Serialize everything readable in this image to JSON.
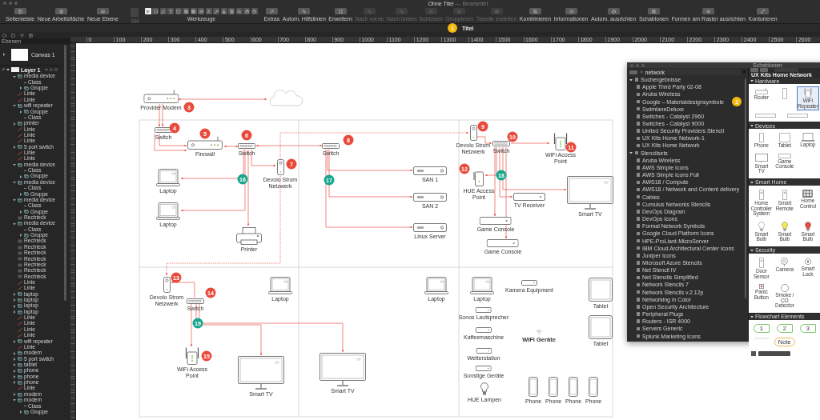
{
  "window": {
    "title": "Ohne Titel",
    "subtitle": "— Bearbeitet"
  },
  "toolbar": {
    "left": [
      {
        "label": "Seitenleiste",
        "disabled": false
      },
      {
        "label": "Neue Arbeitsfläche",
        "disabled": false
      },
      {
        "label": "Neue Ebene",
        "disabled": false
      }
    ],
    "style": {
      "label": "Stil",
      "disabled": true
    },
    "tools": {
      "label": "Werkzeuge",
      "items": [
        {
          "selected": true
        },
        {
          "selected": false
        },
        {
          "selected": false
        },
        {
          "selected": false
        },
        {
          "selected": false
        },
        {
          "selected": false
        },
        {
          "selected": false
        },
        {
          "selected": false
        },
        {
          "selected": false
        },
        {
          "selected": false
        },
        {
          "selected": false
        },
        {
          "selected": false
        },
        {
          "selected": false
        },
        {
          "selected": false
        },
        {
          "selected": false
        }
      ]
    },
    "right": [
      {
        "label": "Extras",
        "disabled": false
      },
      {
        "label": "Autom. Hilfslinien",
        "disabled": false
      },
      {
        "label": "Erweitern",
        "disabled": false
      },
      {
        "label": "Nach vorne",
        "disabled": true
      },
      {
        "label": "Nach hinten",
        "disabled": true
      },
      {
        "label": "Schützen",
        "disabled": true
      },
      {
        "label": "Gruppieren",
        "disabled": true
      },
      {
        "label": "Tabelle erstellen",
        "disabled": true
      },
      {
        "label": "Kombinieren",
        "disabled": false
      },
      {
        "label": "Informationen",
        "disabled": false
      },
      {
        "label": "Autom. ausrichten",
        "disabled": false
      },
      {
        "label": "Schablonen",
        "disabled": false
      },
      {
        "label": "Formen am Raster ausrichten",
        "disabled": false
      },
      {
        "label": "Konturieren",
        "disabled": false
      }
    ]
  },
  "tab_bar": {
    "callout": {
      "label": "1",
      "color": "#f5b80f"
    },
    "tabs": [
      {
        "label": "Titel",
        "selected": true
      }
    ]
  },
  "sidebar": {
    "header": "Ebenen",
    "canvas": {
      "label": "Canvas 1"
    },
    "layer": {
      "label": "Layer 1",
      "expanded": true,
      "children": [
        {
          "label": "media device",
          "kind": "group",
          "expanded": true,
          "children": [
            {
              "label": "Class",
              "kind": "class"
            },
            {
              "label": "Gruppe",
              "kind": "group",
              "expanded": false
            }
          ]
        },
        {
          "label": "Linie",
          "kind": "line"
        },
        {
          "label": "Linie",
          "kind": "line"
        },
        {
          "label": "wifi repeater",
          "kind": "group",
          "expanded": true,
          "children": [
            {
              "label": "Gruppe",
              "kind": "group",
              "expanded": false
            },
            {
              "label": "Class",
              "kind": "class"
            }
          ]
        },
        {
          "label": "printer",
          "kind": "group",
          "expanded": false
        },
        {
          "label": "Linie",
          "kind": "line"
        },
        {
          "label": "Linie",
          "kind": "line"
        },
        {
          "label": "Linie",
          "kind": "line"
        },
        {
          "label": "5 port switch",
          "kind": "group",
          "expanded": false
        },
        {
          "label": "Linie",
          "kind": "line"
        },
        {
          "label": "Linie",
          "kind": "line"
        },
        {
          "label": "media device",
          "kind": "group",
          "expanded": true,
          "children": [
            {
              "label": "Class",
              "kind": "class"
            },
            {
              "label": "Gruppe",
              "kind": "group",
              "expanded": false
            }
          ]
        },
        {
          "label": "media device",
          "kind": "group",
          "expanded": true,
          "children": [
            {
              "label": "Class",
              "kind": "class"
            },
            {
              "label": "Gruppe",
              "kind": "group",
              "expanded": false
            }
          ]
        },
        {
          "label": "media device",
          "kind": "group",
          "expanded": true,
          "children": [
            {
              "label": "Class",
              "kind": "class"
            },
            {
              "label": "Gruppe",
              "kind": "group",
              "expanded": false
            }
          ]
        },
        {
          "label": "Rechteck",
          "kind": "shape"
        },
        {
          "label": "media device",
          "kind": "group",
          "expanded": true,
          "children": [
            {
              "label": "Class",
              "kind": "class"
            },
            {
              "label": "Gruppe",
              "kind": "group",
              "expanded": false
            }
          ]
        },
        {
          "label": "Rechteck",
          "kind": "shape"
        },
        {
          "label": "Rechteck",
          "kind": "shape"
        },
        {
          "label": "Rechteck",
          "kind": "shape"
        },
        {
          "label": "Rechteck",
          "kind": "shape"
        },
        {
          "label": "Rechteck",
          "kind": "shape"
        },
        {
          "label": "Rechteck",
          "kind": "shape"
        },
        {
          "label": "Rechteck",
          "kind": "shape"
        },
        {
          "label": "Linie",
          "kind": "line"
        },
        {
          "label": "Linie",
          "kind": "line"
        },
        {
          "label": "laptop",
          "kind": "group",
          "expanded": false
        },
        {
          "label": "laptop",
          "kind": "group",
          "expanded": false
        },
        {
          "label": "laptop",
          "kind": "group",
          "expanded": false
        },
        {
          "label": "laptop",
          "kind": "group",
          "expanded": false
        },
        {
          "label": "Linie",
          "kind": "line"
        },
        {
          "label": "Linie",
          "kind": "line"
        },
        {
          "label": "Linie",
          "kind": "line"
        },
        {
          "label": "Linie",
          "kind": "line"
        },
        {
          "label": "wifi repeater",
          "kind": "group",
          "expanded": false
        },
        {
          "label": "Linie",
          "kind": "line"
        },
        {
          "label": "modem",
          "kind": "group",
          "expanded": false
        },
        {
          "label": "5 port switch",
          "kind": "group",
          "expanded": false
        },
        {
          "label": "tablet",
          "kind": "group",
          "expanded": false
        },
        {
          "label": "phone",
          "kind": "group",
          "expanded": false
        },
        {
          "label": "phone",
          "kind": "group",
          "expanded": false
        },
        {
          "label": "phone",
          "kind": "group",
          "expanded": false
        },
        {
          "label": "Linie",
          "kind": "line"
        },
        {
          "label": "modem",
          "kind": "group",
          "expanded": false
        },
        {
          "label": "modem",
          "kind": "group",
          "expanded": true,
          "children": [
            {
              "label": "Class",
              "kind": "class"
            },
            {
              "label": "Gruppe",
              "kind": "group",
              "expanded": false
            }
          ]
        }
      ]
    }
  },
  "ruler": {
    "labels": [
      "0",
      "100",
      "200",
      "300",
      "400",
      "500",
      "600",
      "700",
      "800",
      "900",
      "1000",
      "1100",
      "1200",
      "1300",
      "1400",
      "1500",
      "1600",
      "1700",
      "1800",
      "1900",
      "2000",
      "2100",
      "2200",
      "2300",
      "2400",
      "2500",
      "2600"
    ]
  },
  "diagram": {
    "nodes": [
      {
        "label": "Provider Modem",
        "kind": "router"
      },
      {
        "label": "Switch",
        "kind": "switch"
      },
      {
        "label": "Firewall",
        "kind": "router"
      },
      {
        "label": "Switch",
        "kind": "switch"
      },
      {
        "label": "Devolo Strom Netzwerk",
        "kind": "powerline"
      },
      {
        "label": "Switch",
        "kind": "switch"
      },
      {
        "label": "Laptop",
        "kind": "laptop"
      },
      {
        "label": "Laptop",
        "kind": "laptop"
      },
      {
        "label": "Printer",
        "kind": "printer"
      },
      {
        "label": "SAN 1",
        "kind": "server"
      },
      {
        "label": "SAN 2",
        "kind": "server"
      },
      {
        "label": "Linux Server",
        "kind": "server"
      },
      {
        "label": "Devolo Strom Netzwerk",
        "kind": "powerline"
      },
      {
        "label": "Switch",
        "kind": "switch"
      },
      {
        "label": "WiFi Access Point",
        "kind": "access-point"
      },
      {
        "label": "HUE Access Point",
        "kind": "hub"
      },
      {
        "label": "TV Receiver",
        "kind": "box"
      },
      {
        "label": "Smart TV",
        "kind": "tv"
      },
      {
        "label": "Game Console",
        "kind": "box"
      },
      {
        "label": "Game Console",
        "kind": "box"
      },
      {
        "label": "Devolo Strom Netzwerk",
        "kind": "powerline"
      },
      {
        "label": "Switch",
        "kind": "switch"
      },
      {
        "label": "Laptop",
        "kind": "laptop"
      },
      {
        "label": "WiFi Access Point",
        "kind": "access-point"
      },
      {
        "label": "Smart TV",
        "kind": "tv"
      },
      {
        "label": "Smart TV",
        "kind": "tv"
      },
      {
        "label": "Laptop",
        "kind": "laptop"
      },
      {
        "label": "Laptop",
        "kind": "laptop"
      },
      {
        "label": "Kamera Equipment",
        "kind": "small-box"
      },
      {
        "label": "Tablet",
        "kind": "tablet"
      },
      {
        "label": "Sonos Lautsprecher",
        "kind": "small-box"
      },
      {
        "label": "Tablet",
        "kind": "tablet"
      },
      {
        "label": "Kaffeemaschine",
        "kind": "small-box"
      },
      {
        "label": "WiFi Geräte",
        "kind": "wifi-label"
      },
      {
        "label": "Wetterstation",
        "kind": "small-box"
      },
      {
        "label": "Sonstige Geräte",
        "kind": "small-box"
      },
      {
        "label": "HUE Lampen",
        "kind": "bulb"
      },
      {
        "label": "Phone",
        "kind": "phone"
      },
      {
        "label": "Phone",
        "kind": "phone"
      },
      {
        "label": "Phone",
        "kind": "phone"
      },
      {
        "label": "Phone",
        "kind": "phone"
      }
    ],
    "callouts": [
      {
        "label": "3",
        "color": "#e84b3c"
      },
      {
        "label": "4",
        "color": "#e84b3c"
      },
      {
        "label": "5",
        "color": "#e84b3c"
      },
      {
        "label": "6",
        "color": "#e84b3c"
      },
      {
        "label": "7",
        "color": "#e84b3c"
      },
      {
        "label": "8",
        "color": "#e84b3c"
      },
      {
        "label": "9",
        "color": "#e84b3c"
      },
      {
        "label": "10",
        "color": "#e84b3c"
      },
      {
        "label": "11",
        "color": "#e84b3c"
      },
      {
        "label": "12",
        "color": "#e84b3c"
      },
      {
        "label": "13",
        "color": "#e84b3c"
      },
      {
        "label": "14",
        "color": "#e84b3c"
      },
      {
        "label": "15",
        "color": "#e84b3c"
      },
      {
        "label": "16",
        "color": "#17a58c"
      },
      {
        "label": "17",
        "color": "#17a58c"
      },
      {
        "label": "18",
        "color": "#17a58c"
      },
      {
        "label": "19",
        "color": "#17a58c"
      }
    ]
  },
  "template_panel": {
    "title": "Schablonen",
    "callout": {
      "label": "2",
      "color": "#f5b80f"
    },
    "search": {
      "value": "network"
    },
    "groups": [
      {
        "label": "Suchergebnisse",
        "expanded": true,
        "items": [
          "Apple Third Party 02-08",
          "Aruba Wireless",
          "Google – Materialdesignsymbole",
          "SwimlaneDeluxe",
          "Switches - Catalyst 2960",
          "Switches - Catalyst 9000",
          "United Security Providers Stencil",
          "UX Kits Home Network-1",
          "UX Kits Home Network"
        ]
      },
      {
        "label": "Stencilsets",
        "expanded": true,
        "items": [
          "Aruba Wireless",
          "AWS Simple Icons",
          "AWS Simple Icons Full",
          "AWS18 / Compute",
          "AWS18 / Network and Content delivery",
          "Cables",
          "Cumulus Networks Stencils",
          "DevOps Diagram",
          "DevOps Icons",
          "Formal Network Symbols",
          "Google Cloud Platform Icons",
          "HPE-ProLiant-MicroServer",
          "IBM Cloud Architectural Center Icons",
          "Juniper Icons",
          "Microsoft Azure Stencils",
          "Net Stencil IV",
          "Net Stencils Simplified",
          "Network Stencils 7",
          "Network Stencils v.2.12p",
          "Networking in Color",
          "Open Security Architecture",
          "Peripheral Plugs",
          "Routers - ISR 4000",
          "Servers Generic",
          "Splunk Marketing Icons"
        ]
      }
    ],
    "preview": {
      "heading": "UX Kits Home Network",
      "sections": [
        {
          "label": "Hardware",
          "expanded": true,
          "shapes": [
            {
              "label": "Router",
              "kind": "router",
              "selected": false
            },
            {
              "kind": "powerline",
              "selected": false
            },
            {
              "label": "WiFi Repeater",
              "kind": "repeater",
              "selected": true
            },
            {
              "kind": "switch",
              "selected": false
            },
            {
              "kind": "switch",
              "selected": false
            }
          ]
        },
        {
          "label": "Devices",
          "expanded": true,
          "shapes": [
            {
              "label": "Phone",
              "kind": "phone",
              "selected": false
            },
            {
              "label": "Tablet",
              "kind": "tablet",
              "selected": false
            },
            {
              "label": "Laptop",
              "kind": "laptop",
              "selected": false
            },
            {
              "label": "Smart TV",
              "kind": "tv",
              "selected": false
            },
            {
              "label": "Game Console",
              "kind": "console",
              "selected": false
            }
          ]
        },
        {
          "label": "Smart Home",
          "expanded": true,
          "shapes": [
            {
              "label": "Home Controller System",
              "kind": "remote",
              "selected": false
            },
            {
              "label": "Smart Remote",
              "kind": "remote",
              "selected": false
            },
            {
              "label": "Home Control",
              "kind": "panel",
              "selected": false
            },
            {
              "label": "Smart Bulb",
              "kind": "bulb",
              "color": "#ffffff",
              "selected": false
            },
            {
              "label": "Smart Bulb",
              "kind": "bulb",
              "color": "#f2e94e",
              "selected": false
            },
            {
              "label": "Smart Bulb",
              "kind": "bulb",
              "color": "#e84b3c",
              "selected": false
            }
          ]
        },
        {
          "label": "Security",
          "expanded": true,
          "shapes": [
            {
              "label": "Door Sensor",
              "kind": "remote",
              "selected": false
            },
            {
              "label": "Camera",
              "kind": "camera",
              "selected": false
            },
            {
              "label": "Smart Lock",
              "kind": "lock",
              "selected": false
            },
            {
              "label": "Panic Button",
              "kind": "button",
              "selected": false
            },
            {
              "label": "Smoke / CO Detector",
              "kind": "detector",
              "selected": false
            }
          ]
        },
        {
          "label": "Flowchart Elements",
          "expanded": true,
          "shapes": [
            {
              "label": "1",
              "kind": "step",
              "selected": false
            },
            {
              "label": "2",
              "kind": "step",
              "selected": false
            },
            {
              "label": "3",
              "kind": "step",
              "selected": false
            },
            {
              "kind": "line",
              "selected": false
            },
            {
              "label": "Note",
              "kind": "note",
              "selected": false
            }
          ]
        }
      ]
    }
  }
}
